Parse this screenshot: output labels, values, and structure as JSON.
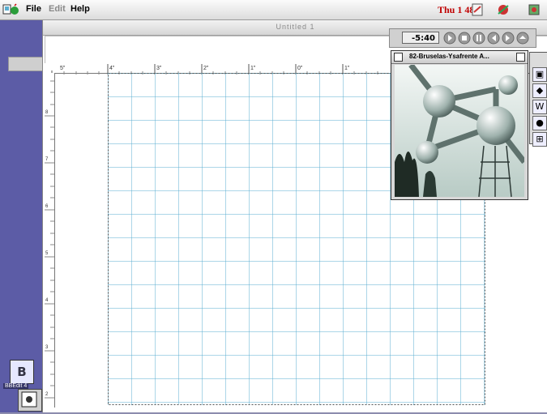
{
  "menubar": {
    "items": [
      "File",
      "Edit",
      "Help"
    ],
    "clock": "Thu 1 48"
  },
  "document": {
    "title": "Untitled 1",
    "ruler_top_labels": [
      "5\"",
      "4\"",
      "3\"",
      "2\"",
      "1\"",
      "0\"",
      "1\""
    ],
    "ruler_left_labels": [
      "8",
      "7",
      "6",
      "5",
      "4",
      "3",
      "2"
    ]
  },
  "player": {
    "time": "-5:40"
  },
  "movie": {
    "title": "82-Bruselas-Ysafrente A..."
  },
  "desktop": {
    "bbedit_label": "BBEdit 4"
  },
  "icons": {
    "apple": "apple-menu-icon",
    "finder": "finder-icon",
    "bbedit": "bbedit-icon"
  },
  "colors": {
    "grid": "#5aaed0",
    "clock": "#c00000",
    "desktop": "#5c5ca6"
  }
}
